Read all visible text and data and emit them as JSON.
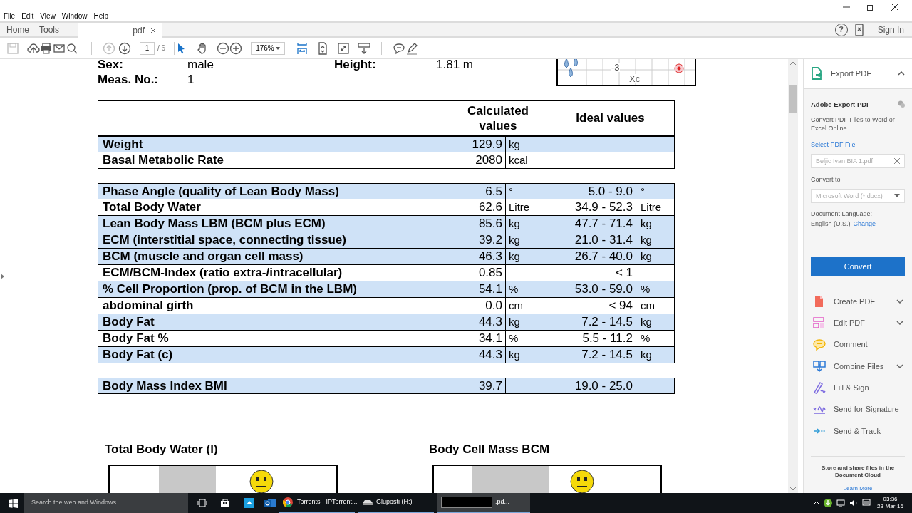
{
  "menu": [
    "File",
    "Edit",
    "View",
    "Window",
    "Help"
  ],
  "tabs": [
    {
      "label": "Home",
      "selected": false
    },
    {
      "label": "Tools",
      "selected": false
    },
    {
      "label": "pdf",
      "selected": true,
      "closable": true
    }
  ],
  "header_right": {
    "help": "?",
    "sign_in": "Sign In"
  },
  "toolbar": {
    "page": "1",
    "pages": "/ 6",
    "zoom": "176%"
  },
  "document": {
    "info": [
      {
        "label": "Sex:",
        "value": "male"
      },
      {
        "label": "Meas. No.:",
        "value": "1"
      }
    ],
    "info_right": {
      "label": "Height:",
      "value": "1.81 m"
    },
    "chart_fragment": {
      "labels": [
        "-3",
        "Xc"
      ]
    },
    "table": {
      "columns": [
        "",
        "Calculated values",
        "Ideal values"
      ],
      "groups": [
        [
          {
            "label": "Weight",
            "value": "129.9",
            "unit": "kg",
            "highlighted": true
          },
          {
            "label": "Basal Metabolic Rate",
            "value": "2080",
            "unit": "kcal",
            "highlighted": false
          }
        ],
        [
          {
            "label": "Phase Angle (quality of Lean Body Mass)",
            "value": "6.5",
            "unit": "°",
            "ideal": "5.0 - 9.0",
            "ideal_unit": "°",
            "highlighted": true
          },
          {
            "label": "Total Body Water",
            "value": "62.6",
            "unit": "Litre",
            "ideal": "34.9 - 52.3",
            "ideal_unit": "Litre",
            "highlighted": false
          },
          {
            "label": "Lean Body Mass LBM (BCM plus ECM)",
            "value": "85.6",
            "unit": "kg",
            "ideal": "47.7 - 71.4",
            "ideal_unit": "kg",
            "highlighted": true
          },
          {
            "label": "ECM (interstitial space, connecting tissue)",
            "value": "39.2",
            "unit": "kg",
            "ideal": "21.0 - 31.4",
            "ideal_unit": "kg",
            "highlighted": true
          },
          {
            "label": "BCM (muscle and organ cell mass)",
            "value": "46.3",
            "unit": "kg",
            "ideal": "26.7 - 40.0",
            "ideal_unit": "kg",
            "highlighted": true
          },
          {
            "label": "ECM/BCM-Index (ratio extra-/intracellular)",
            "value": "0.85",
            "ideal": "< 1",
            "highlighted": false
          },
          {
            "label": "% Cell Proportion (prop. of BCM in the LBM)",
            "value": "54.1",
            "unit": "%",
            "ideal": "53.0 - 59.0",
            "ideal_unit": "%",
            "highlighted": true
          },
          {
            "label": "abdominal girth",
            "value": "0.0",
            "unit": "cm",
            "ideal": "< 94",
            "ideal_unit": "cm",
            "highlighted": false
          },
          {
            "label": "Body Fat",
            "value": "44.3",
            "unit": "kg",
            "ideal": "7.2 - 14.5",
            "ideal_unit": "kg",
            "highlighted": true
          },
          {
            "label": "Body Fat %",
            "value": "34.1",
            "unit": "%",
            "ideal": "5.5 - 11.2",
            "ideal_unit": "%",
            "highlighted": false
          },
          {
            "label": "Body Fat (c)",
            "value": "44.3",
            "unit": "kg",
            "ideal": "7.2 - 14.5",
            "ideal_unit": "kg",
            "highlighted": true
          }
        ],
        [
          {
            "label": "Body Mass Index BMI",
            "value": "39.7",
            "ideal": "19.0 - 25.0",
            "highlighted": true
          }
        ]
      ]
    },
    "charts": [
      {
        "title": "Total Body Water (l)"
      },
      {
        "title": "Body Cell Mass BCM"
      }
    ]
  },
  "right_pane": {
    "export": {
      "title": "Export PDF",
      "expanded": true,
      "heading": "Adobe Export PDF",
      "description": "Convert PDF Files to Word or Excel Online",
      "select_label": "Select PDF File",
      "file": "Beljic Ivan BIA 1.pdf",
      "convert_to_label": "Convert to",
      "format": "Microsoft Word (*.docx)",
      "language_label": "Document Language:",
      "language": "English (U.S.)",
      "change": "Change",
      "button": "Convert"
    },
    "tools": [
      {
        "label": "Create PDF",
        "kind": "create",
        "expandable": true
      },
      {
        "label": "Edit PDF",
        "kind": "edit",
        "expandable": true
      },
      {
        "label": "Comment",
        "kind": "comment",
        "expandable": false
      },
      {
        "label": "Combine Files",
        "kind": "combine",
        "expandable": true
      },
      {
        "label": "Fill & Sign",
        "kind": "fill",
        "expandable": false
      },
      {
        "label": "Send for Signature",
        "kind": "signature",
        "expandable": false
      },
      {
        "label": "Send & Track",
        "kind": "track",
        "expandable": false
      }
    ],
    "footer": "Store and share files in the Document Cloud",
    "learn_more": "Learn More"
  },
  "taskbar": {
    "search": "Search the web and Windows",
    "apps": [
      {
        "label": "Torrents - IPTorrent...",
        "kind": "browser"
      },
      {
        "label": "Gluposti (H:)",
        "kind": "drive"
      },
      {
        "label": ".pd...",
        "kind": "redacted"
      }
    ],
    "time": "03:36",
    "date": "23-Mar-16"
  }
}
